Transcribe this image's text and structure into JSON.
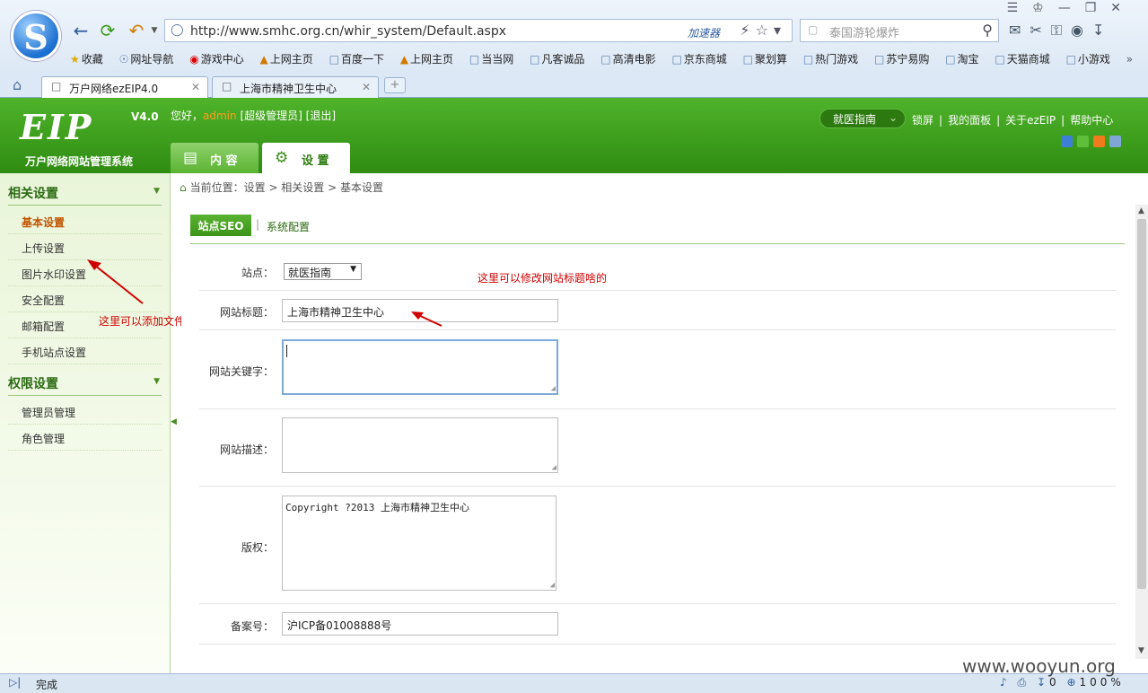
{
  "browser": {
    "logo_letter": "S",
    "url": "http://www.smhc.org.cn/whir_system/Default.aspx",
    "accelerator": "加速器",
    "search_placeholder": "泰国游轮爆炸",
    "bookmarks": [
      "收藏",
      "网址导航",
      "游戏中心",
      "上网主页",
      "百度一下",
      "上网主页",
      "当当网",
      "凡客诚品",
      "高清电影",
      "京东商城",
      "聚划算",
      "热门游戏",
      "苏宁易购",
      "淘宝",
      "天猫商城",
      "小游戏"
    ],
    "tabs": [
      {
        "title": "万户网络ezEIP4.0"
      },
      {
        "title": "上海市精神卫生中心"
      }
    ],
    "status_text": "完成",
    "zoom": "100%",
    "download_count": "0"
  },
  "app": {
    "brand_logo": "EIP",
    "brand_version": "V4.0",
    "brand_name": "万户网络网站管理系统",
    "greet_prefix": "您好，",
    "username": "admin",
    "greet_suffix": "[超级管理员] [退出]",
    "site_selector": "就医指南",
    "top_links": [
      "锁屏",
      "我的面板",
      "关于ezEIP",
      "帮助中心"
    ],
    "theme_colors": [
      "#3d7fd6",
      "#5fbf3a",
      "#f07a1c",
      "#7fa6d4"
    ],
    "main_tabs": [
      {
        "label": "内 容"
      },
      {
        "label": "设 置"
      }
    ]
  },
  "sidebar": {
    "groups": [
      {
        "title": "相关设置",
        "items": [
          "基本设置",
          "上传设置",
          "图片水印设置",
          "安全配置",
          "邮箱配置",
          "手机站点设置"
        ]
      },
      {
        "title": "权限设置",
        "items": [
          "管理员管理",
          "角色管理"
        ]
      }
    ]
  },
  "breadcrumb": "当前位置：设置 > 相关设置 > 基本设置",
  "subtabs": {
    "seo": "站点SEO",
    "sep": "|",
    "system": "系统配置"
  },
  "form": {
    "site_label": "站点：",
    "site_value": "就医指南",
    "title_label": "网站标题：",
    "title_value": "上海市精神卫生中心",
    "keywords_label": "网站关键字：",
    "keywords_value": "",
    "desc_label": "网站描述：",
    "desc_value": "",
    "copyright_label": "版权：",
    "copyright_value": "Copyright ?2013 上海市精神卫生中心",
    "icp_label": "备案号：",
    "icp_value": "沪ICP备01008888号"
  },
  "annotations": {
    "title_note": "这里可以修改网站标题啥的",
    "upload_note": "这里可以添加文件后缀"
  },
  "watermark": "www.wooyun.org"
}
